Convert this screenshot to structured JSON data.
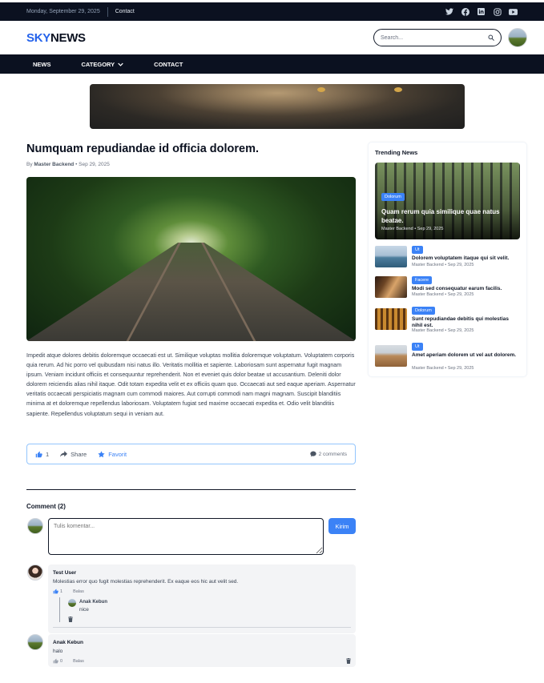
{
  "topbar": {
    "date": "Monday, September 29, 2025",
    "contact": "Contact",
    "social_icons": [
      "twitter-icon",
      "facebook-icon",
      "linkedin-icon",
      "instagram-icon",
      "youtube-icon"
    ]
  },
  "header": {
    "logo_part1": "SKY",
    "logo_part2": "NEWS",
    "search_placeholder": "Search..."
  },
  "nav": {
    "items": [
      "NEWS",
      "CATEGORY",
      "CONTACT"
    ]
  },
  "article": {
    "title": "Numquam repudiandae id officia dolorem.",
    "by_prefix": "By",
    "author": "Master Backend",
    "date": "Sep 29, 2025",
    "body": "Impedit atque dolores debitis doloremque occaecati est ut. Similique voluptas mollitia doloremque voluptatum. Voluptatem corporis quia rerum. Ad hic porro vel quibusdam nisi natus illo. Veritatis mollitia et sapiente. Laboriosam sunt aspernatur fugit magnam ipsum. Veniam incidunt officiis et consequuntur reprehenderit. Non et eveniet quis dolor beatae ut accusantium. Deleniti dolor dolorem reiciendis alias nihil itaque. Odit totam expedita velit et ex officiis quam quo. Occaecati aut sed eaque aperiam. Aspernatur veritatis occaecati perspiciatis magnam cum commodi maiores. Aut corrupti commodi nam magni magnam. Suscipit blanditiis minima at et doloremque repellendus laboriosam. Voluptatem fugiat sed maxime occaecati expedita et. Odio velit blanditiis sapiente. Repellendus voluptatum sequi in veniam aut."
  },
  "actions": {
    "like_count": "1",
    "share_label": "Share",
    "favorite_label": "Favorit",
    "comments_label": "2 comments"
  },
  "comments": {
    "heading": "Comment (2)",
    "input_placeholder": "Tulis komentar...",
    "submit_label": "Kirim",
    "list": [
      {
        "name": "Test User",
        "text": "Molestias error quo fugit molestias reprehenderit. Ex eaque eos hic aut velit sed.",
        "likes": "1",
        "reply_label": "Balas",
        "replies": [
          {
            "name": "Anak Kebun",
            "text": "nice"
          }
        ]
      },
      {
        "name": "Anak Kebun",
        "text": "halo",
        "likes": "0",
        "reply_label": "Balas"
      }
    ]
  },
  "sidebar": {
    "title": "Trending News",
    "featured": {
      "badge": "Dolorum",
      "title": "Quam rerum quia similique quae natus beatae.",
      "meta": "Master Backend • Sep 29, 2025"
    },
    "items": [
      {
        "badge": "Ut",
        "title": "Dolorem voluptatem itaque qui sit velit.",
        "meta": "Master Backend • Sep 29, 2025"
      },
      {
        "badge": "Facere",
        "title": "Modi sed consequatur earum facilis.",
        "meta": "Master Backend • Sep 29, 2025"
      },
      {
        "badge": "Dolorum",
        "title": "Sunt repudiandae debitis qui molestias nihil est.",
        "meta": "Master Backend • Sep 29, 2025"
      },
      {
        "badge": "Ut",
        "title": "Amet aperiam dolorem ut vel aut dolorem.",
        "meta": "Master Backend • Sep 29, 2025"
      }
    ]
  },
  "colors": {
    "navy": "#0b1120",
    "accent": "#3b82f6",
    "logo_blue": "#2563eb"
  }
}
